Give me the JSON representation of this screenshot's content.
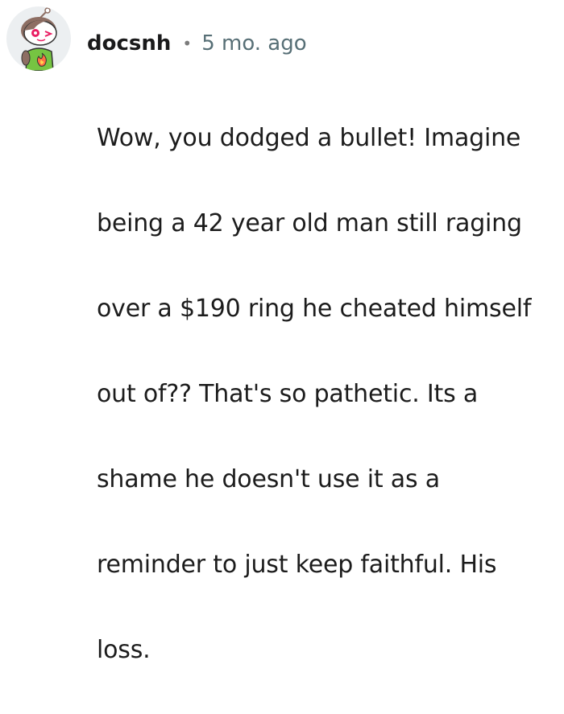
{
  "comment": {
    "author": "docsnh",
    "separator": "•",
    "timestamp": "5 mo. ago",
    "lines": [
      "Wow, you dodged a bullet! Imagine",
      "being a 42 year old man still raging",
      "over a $190 ring he cheated himself",
      "out of?? That's so pathetic. Its a",
      "shame he doesn't use it as a",
      "reminder to just keep faithful. His",
      "loss."
    ],
    "avatar_icon": "reddit-snoo-avatar-icon"
  },
  "colors": {
    "avatar_bg": "#eceff1",
    "hair": "#8d6e63",
    "eye": "#e91e63",
    "shirt": "#76c442",
    "username": "#1a1a1b",
    "timestamp": "#576f76"
  }
}
